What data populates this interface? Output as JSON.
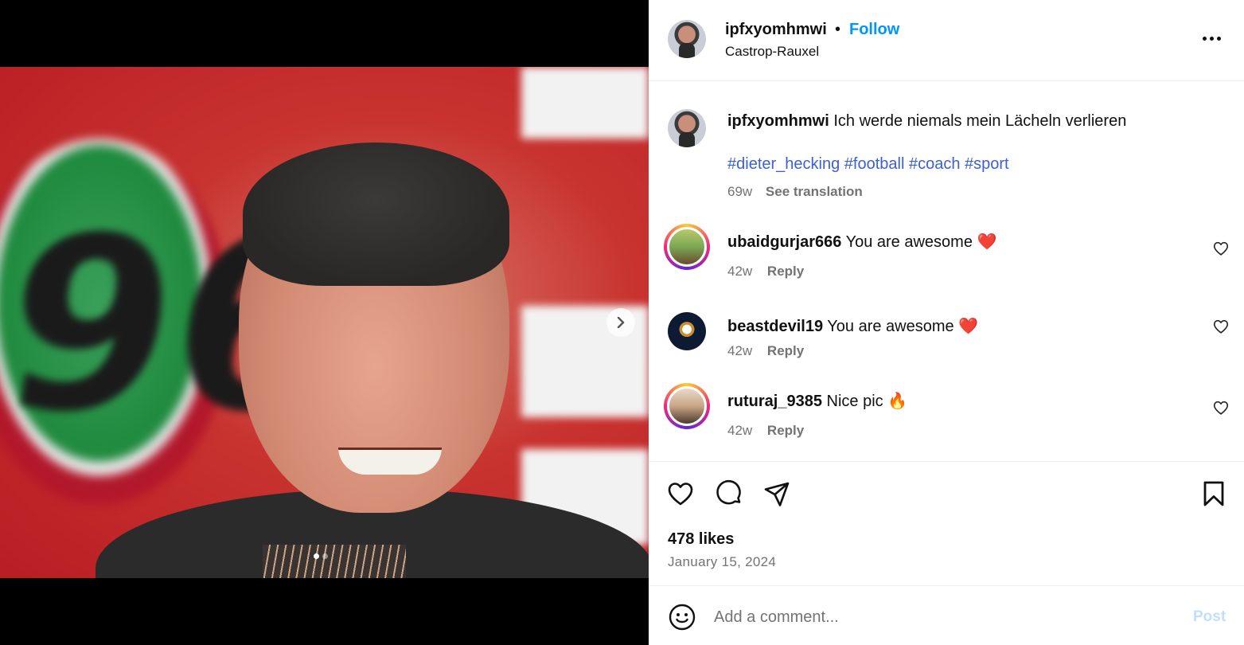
{
  "post": {
    "username": "ipfxyomhmwi",
    "separator": "•",
    "follow_label": "Follow",
    "location": "Castrop-Rauxel",
    "caption": "Ich werde niemals mein Lächeln verlieren",
    "hashtags": [
      "#dieter_hecking",
      "#football",
      "#coach",
      "#sport"
    ],
    "age": "69w",
    "see_translation": "See translation",
    "likes": "478 likes",
    "date": "January 15, 2024"
  },
  "comments": [
    {
      "username": "ubaidgurjar666",
      "text": "You are awesome ❤️",
      "age": "42w",
      "reply_label": "Reply"
    },
    {
      "username": "beastdevil19",
      "text": "You are awesome ❤️",
      "age": "42w",
      "reply_label": "Reply"
    },
    {
      "username": "ruturaj_9385",
      "text": "Nice pic 🔥",
      "age": "42w",
      "reply_label": "Reply"
    }
  ],
  "composer": {
    "placeholder": "Add a comment...",
    "post_label": "Post"
  },
  "media": {
    "slide_count": 2,
    "active_slide": 1
  },
  "colors": {
    "link_blue": "#0095f6",
    "hashtag_blue": "#3b5fd9",
    "muted": "#737373",
    "post_disabled": "#c0dffd"
  }
}
